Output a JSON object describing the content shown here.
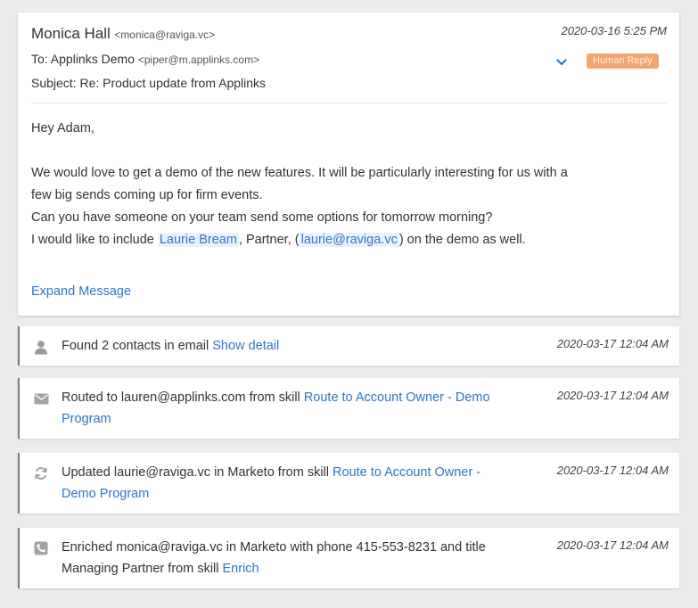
{
  "email": {
    "from_name": "Monica Hall",
    "from_email": "<monica@raviga.vc>",
    "date": "2020-03-16 5:25 PM",
    "to_label": "To: Applinks Demo",
    "to_email": "<piper@m.applinks.com>",
    "subject": "Subject: Re: Product update from Applinks",
    "badge": "Human Reply",
    "greeting": "Hey Adam,",
    "line1": "We would love to get a demo of the new features. It will be particularly interesting for us with a",
    "line2": "few big sends coming up for firm events.",
    "line3": "Can you have someone on your team send some options for tomorrow morning?",
    "line4_pre": "I would like to include ",
    "line4_name": "Laurie Bream",
    "line4_mid": ", Partner, (",
    "line4_email": "laurie@raviga.vc",
    "line4_post": ") on the demo as well.",
    "expand": "Expand Message"
  },
  "activities": [
    {
      "icon": "person-icon",
      "date": "2020-03-17 12:04 AM",
      "t1": "Found 2 contacts in email ",
      "link": "Show detail"
    },
    {
      "icon": "envelope-icon",
      "date": "2020-03-17 12:04 AM",
      "t1": "Routed to lauren@applinks.com from skill ",
      "link": "Route to Account Owner - Demo Program"
    },
    {
      "icon": "refresh-icon",
      "date": "2020-03-17 12:04 AM",
      "t1": "Updated laurie@raviga.vc in Marketo from skill ",
      "link": "Route to Account Owner - Demo Program"
    },
    {
      "icon": "phone-icon",
      "date": "2020-03-17 12:04 AM",
      "t1": "Enriched monica@raviga.vc in Marketo with phone ",
      "phone": "415-553-8231",
      "t2": " and title ",
      "title": "Managing Partner",
      "t3": " from skill ",
      "link": "Enrich"
    }
  ],
  "colors": {
    "link": "#2d77c4",
    "badge": "#f3a56f",
    "highlight": "#eaf2fb"
  }
}
